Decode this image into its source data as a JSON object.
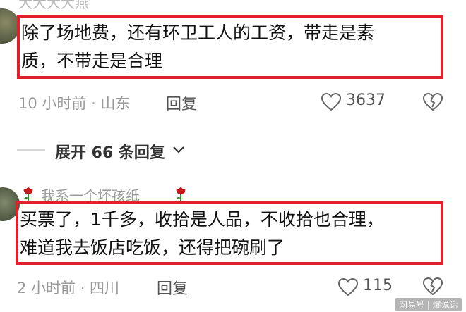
{
  "comment1": {
    "username": "大大大大燕",
    "text_line1": "除了场地费，还有环卫工人的工资，带走是素",
    "text_line2": "质，不带走是合理",
    "time_location": "10 小时前 · 山东",
    "reply_label": "回复",
    "like_count": "3637"
  },
  "expand_replies": {
    "label": "展开 66 条回复"
  },
  "comment2": {
    "username": "我系一个坏孩纸",
    "text_line1": "买票了，1千多，收拾是人品，不收拾也合理，",
    "text_line2": "难道我去饭店吃饭，还得把碗刷了",
    "time_location": "2 小时前 · 四川",
    "reply_label": "回复",
    "like_count": "115"
  },
  "watermark": {
    "text": "网易号 | 爆说话"
  },
  "colors": {
    "highlight_box": "#e0202a",
    "secondary_text": "#9a9a9a"
  },
  "icons": [
    "heart-icon",
    "broken-heart-icon",
    "chevron-down-icon",
    "rose-icon"
  ]
}
